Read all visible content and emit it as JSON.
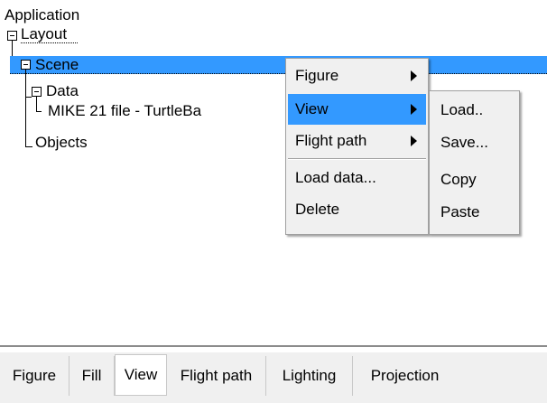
{
  "tree": {
    "root": "Application",
    "layout": "Layout",
    "scene": "Scene",
    "data": "Data",
    "mike_file": "MIKE 21 file - TurtleBa",
    "objects": "Objects"
  },
  "context_menu": {
    "items": [
      {
        "label": "Figure",
        "has_submenu": true
      },
      {
        "label": "View",
        "has_submenu": true,
        "highlighted": true
      },
      {
        "label": "Flight path",
        "has_submenu": true
      },
      {
        "label": "Load data...",
        "has_submenu": false
      },
      {
        "label": "Delete",
        "has_submenu": false
      }
    ],
    "submenu": {
      "items": [
        {
          "label": "Load.."
        },
        {
          "label": "Save..."
        },
        {
          "label": "Copy"
        },
        {
          "label": "Paste"
        }
      ]
    }
  },
  "tabs": [
    {
      "label": "Figure"
    },
    {
      "label": "Fill"
    },
    {
      "label": "View",
      "selected": true
    },
    {
      "label": "Flight path"
    },
    {
      "label": "Lighting"
    },
    {
      "label": "Projection"
    }
  ],
  "colors": {
    "selection": "#3399ff",
    "menu_bg": "#f0f0f0",
    "tab_bar_bg": "#f0f0f0"
  }
}
